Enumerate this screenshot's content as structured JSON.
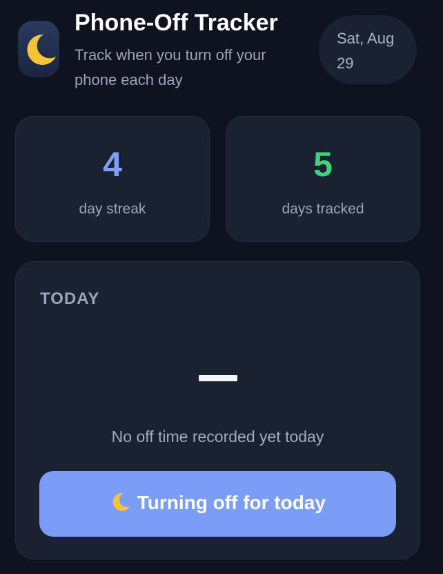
{
  "header": {
    "title": "Phone-Off Tracker",
    "subtitle": "Track when you turn off your phone each day",
    "app_icon": "crescent-moon-icon",
    "date_line1": "Sat, Aug",
    "date_line2": "29"
  },
  "stats": {
    "streak_value": "4",
    "streak_label": "day streak",
    "tracked_value": "5",
    "tracked_label": "days tracked"
  },
  "today": {
    "label": "TODAY",
    "time_display": "—",
    "status": "No off time recorded yet today",
    "button_label": "Turning off for today",
    "button_icon": "crescent-moon-icon"
  },
  "colors": {
    "background": "#0e131f",
    "card": "#1a2131",
    "accent_blue": "#7b9cf7",
    "streak_blue": "#7f9ef6",
    "tracked_green": "#3dd37a",
    "moon_yellow": "#f6c33b"
  }
}
